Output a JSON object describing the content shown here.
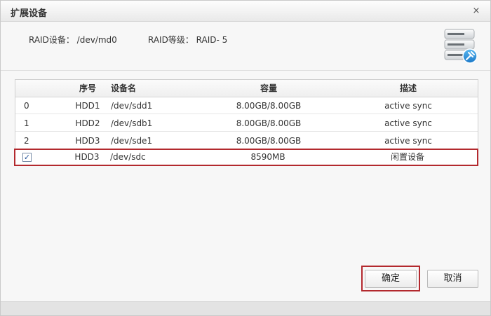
{
  "dialog": {
    "title": "扩展设备",
    "close_glyph": "×"
  },
  "info": {
    "raid_device": "RAID设备： /dev/md0",
    "raid_level": "RAID等级： RAID- 5",
    "icon": "server-tools-icon"
  },
  "table": {
    "headers": [
      "序号",
      "设备名",
      "",
      "容量",
      "描述"
    ],
    "rows": [
      {
        "index": "0",
        "name": "HDD1",
        "device": "/dev/sdd1",
        "capacity": "8.00GB/8.00GB",
        "desc": "active sync"
      },
      {
        "index": "1",
        "name": "HDD2",
        "device": "/dev/sdb1",
        "capacity": "8.00GB/8.00GB",
        "desc": "active sync"
      },
      {
        "index": "2",
        "name": "HDD3",
        "device": "/dev/sde1",
        "capacity": "8.00GB/8.00GB",
        "desc": "active sync"
      }
    ],
    "selectable_row": {
      "checked_glyph": "✓",
      "name": "HDD3",
      "device": "/dev/sdc",
      "capacity": "8590MB",
      "desc": "闲置设备"
    }
  },
  "buttons": {
    "ok": "确定",
    "cancel": "取消"
  },
  "colors": {
    "highlight": "#b3292e",
    "checkbox_mark": "#1f4f95"
  }
}
